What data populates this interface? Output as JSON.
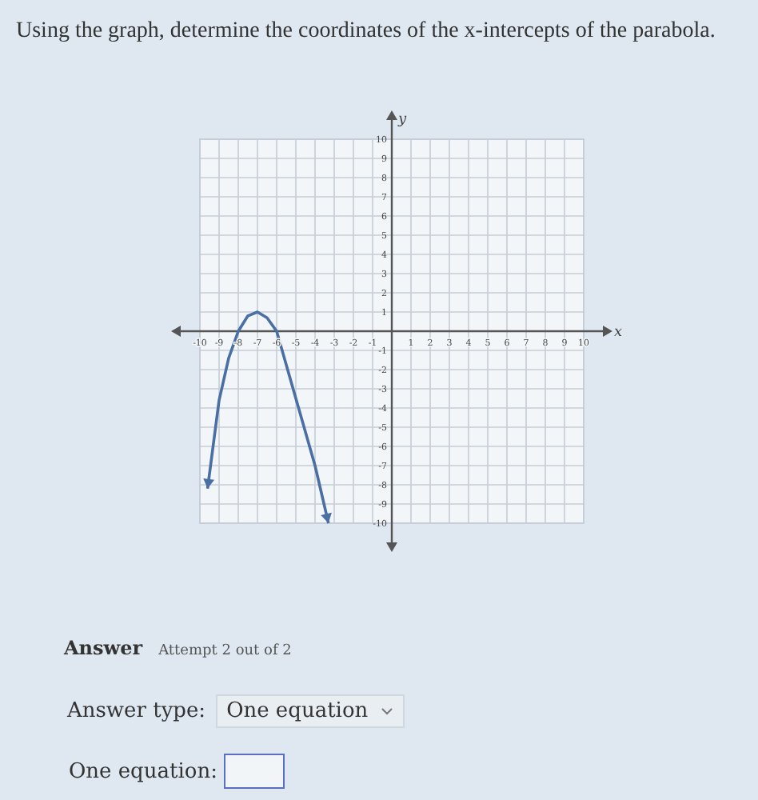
{
  "question": "Using the graph, determine the coordinates of the x-intercepts of the parabola.",
  "graph": {
    "chart_data": {
      "type": "line",
      "grid": true,
      "xlabel": "x",
      "ylabel": "y",
      "xlim": [
        -10,
        10
      ],
      "ylim": [
        -10,
        10
      ],
      "xticks": [
        -10,
        -9,
        -8,
        -7,
        -6,
        -5,
        -4,
        -3,
        -2,
        -1,
        1,
        2,
        3,
        4,
        5,
        6,
        7,
        8,
        9,
        10
      ],
      "yticks": [
        -10,
        -9,
        -8,
        -7,
        -6,
        -5,
        -4,
        -3,
        -2,
        -1,
        1,
        2,
        3,
        4,
        5,
        6,
        7,
        8,
        9,
        10
      ],
      "x": [
        -9.6,
        -9,
        -8.5,
        -8,
        -7.5,
        -7,
        -6.5,
        -6,
        -5,
        -4,
        -3.3
      ],
      "series": [
        {
          "color": "#4a6fa5",
          "values": [
            -8.2,
            -3.6,
            -1.4,
            0,
            0.8,
            1,
            0.7,
            0,
            -3.5,
            -7,
            -10
          ]
        }
      ]
    }
  },
  "answer": {
    "label": "Answer",
    "attempt": "Attempt 2 out of 2"
  },
  "answer_type": {
    "label": "Answer type:",
    "value": "One equation"
  },
  "equation": {
    "label": "One equation:"
  }
}
